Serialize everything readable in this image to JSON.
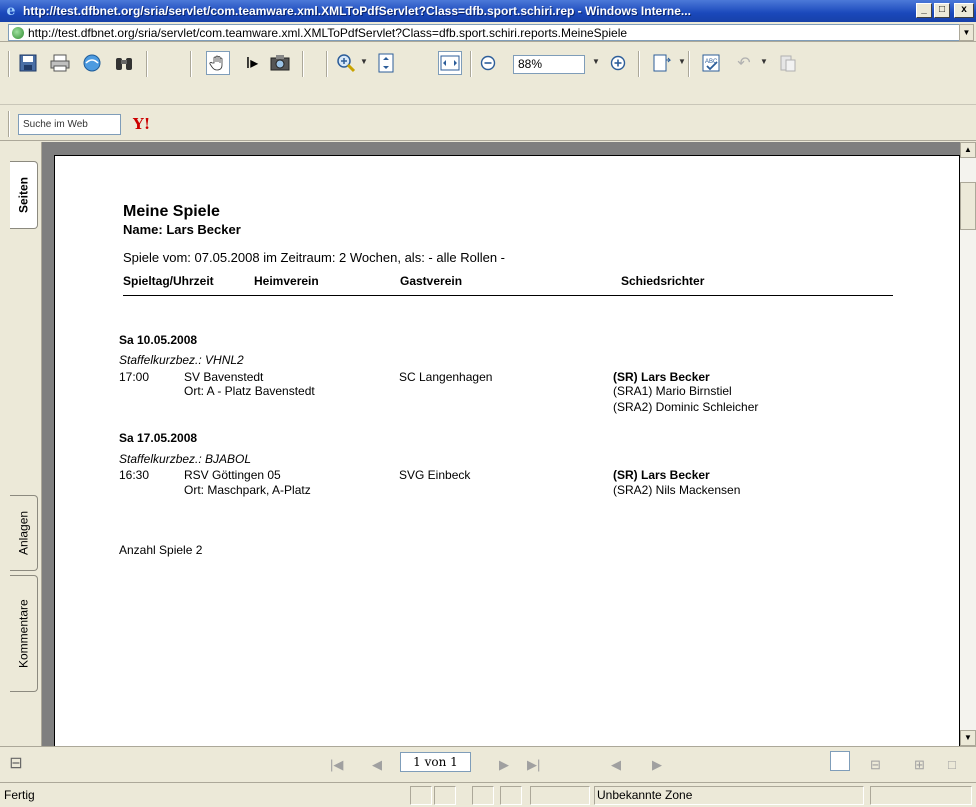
{
  "window": {
    "title": "http://test.dfbnet.org/sria/servlet/com.teamware.xml.XMLToPdfServlet?Class=dfb.sport.schiri.rep - Windows Interne...",
    "minimize": "_",
    "maximize": "□",
    "close": "x"
  },
  "address": {
    "url": "http://test.dfbnet.org/sria/servlet/com.teamware.xml.XMLToPdfServlet?Class=dfb.sport.schiri.reports.MeineSpiele"
  },
  "toolbar": {
    "zoom": "88%"
  },
  "search": {
    "placeholder": "Suche im Web",
    "logo": "Y!"
  },
  "sidebar": {
    "tabs": [
      "Seiten",
      "Anlagen",
      "Kommentare"
    ]
  },
  "document": {
    "title": "Meine Spiele",
    "name": "Name: Lars Becker",
    "range": "Spiele vom: 07.05.2008 im Zeitraum: 2 Wochen, als: - alle Rollen -",
    "columns": [
      "Spieltag/Uhrzeit",
      "Heimverein",
      "Gastverein",
      "Schiedsrichter"
    ],
    "matches": [
      {
        "date": "Sa 10.05.2008",
        "staffel": "Staffelkurzbez.: VHNL2",
        "time": "17:00",
        "home": "SV Bavenstedt",
        "place": "Ort: A - Platz Bavenstedt",
        "guest": "SC Langenhagen",
        "referees": [
          "(SR) Lars Becker",
          "(SRA1) Mario Birnstiel",
          "(SRA2) Dominic Schleicher"
        ]
      },
      {
        "date": "Sa 17.05.2008",
        "staffel": "Staffelkurzbez.: BJABOL",
        "time": "16:30",
        "home": "RSV Göttingen 05",
        "place": "Ort: Maschpark, A-Platz",
        "guest": "SVG Einbeck",
        "referees": [
          "(SR) Lars Becker",
          "(SRA2) Nils Mackensen"
        ]
      }
    ],
    "total": "Anzahl Spiele 2"
  },
  "navigation": {
    "page": "1 von 1"
  },
  "status": {
    "text": "Fertig",
    "zone": "Unbekannte Zone"
  }
}
